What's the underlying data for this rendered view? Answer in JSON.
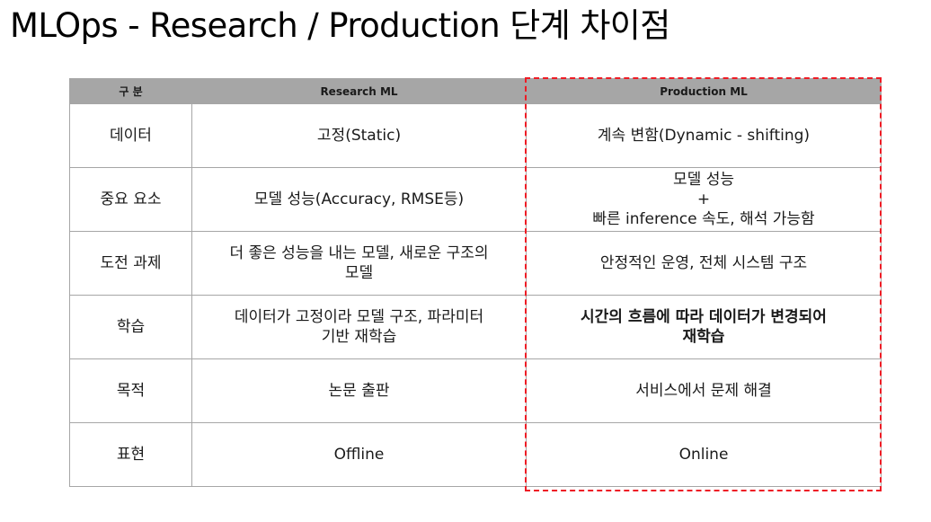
{
  "slide": {
    "title": "MLOps - Research / Production 단계 차이점"
  },
  "table": {
    "headers": [
      "구 분",
      "Research ML",
      "Production ML"
    ],
    "rows": [
      {
        "label": "데이터",
        "research": "고정(Static)",
        "production": "계속 변함(Dynamic - shifting)"
      },
      {
        "label": "중요 요소",
        "research": "모델 성능(Accuracy, RMSE등)",
        "production": "모델 성능\n+\n빠른 inference 속도, 해석 가능함"
      },
      {
        "label": "도전 과제",
        "research": "더 좋은 성능을 내는 모델, 새로운 구조의\n모델",
        "production": "안정적인 운영, 전체 시스템 구조"
      },
      {
        "label": "학습",
        "research": "데이터가 고정이라 모델 구조, 파라미터\n기반 재학습",
        "production": "시간의 흐름에 따라 데이터가 변경되어\n재학습"
      },
      {
        "label": "목적",
        "research": "논문 출판",
        "production": "서비스에서 문제 해결"
      },
      {
        "label": "표현",
        "research": "Offline",
        "production": "Online"
      }
    ]
  },
  "highlight": {
    "color": "#ee1c25"
  }
}
